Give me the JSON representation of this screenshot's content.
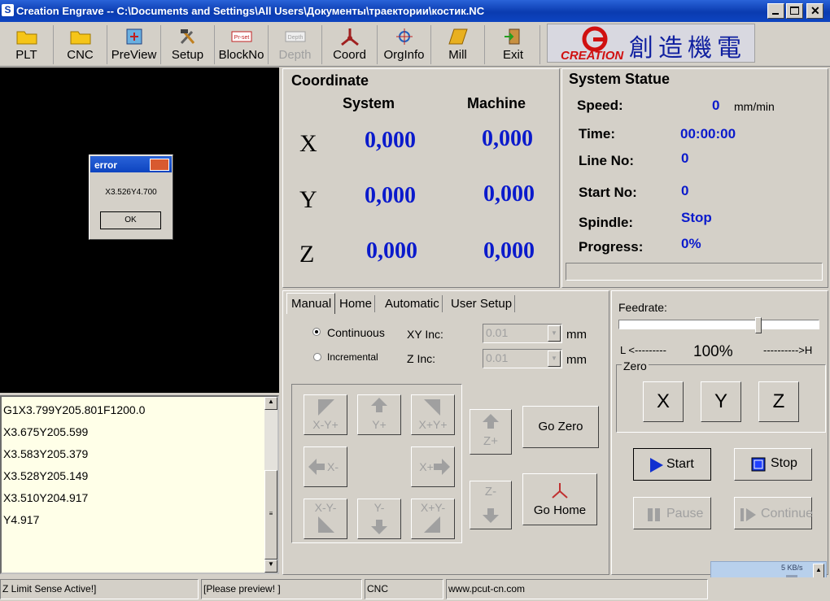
{
  "window": {
    "title": "Creation Engrave -- C:\\Documents and Settings\\All Users\\Документы\\траектории\\костик.NC"
  },
  "toolbar": [
    {
      "label": "PLT",
      "icon": "folder-icon",
      "enabled": true
    },
    {
      "label": "CNC",
      "icon": "folder-icon",
      "enabled": true
    },
    {
      "label": "PreView",
      "icon": "preview-icon",
      "enabled": true
    },
    {
      "label": "Setup",
      "icon": "tools-icon",
      "enabled": true
    },
    {
      "label": "BlockNo",
      "icon": "blockno-icon",
      "enabled": true
    },
    {
      "label": "Depth",
      "icon": "depth-icon",
      "enabled": false
    },
    {
      "label": "Coord",
      "icon": "coord-icon",
      "enabled": true
    },
    {
      "label": "OrgInfo",
      "icon": "orginfo-icon",
      "enabled": true
    },
    {
      "label": "Mill",
      "icon": "mill-icon",
      "enabled": true
    },
    {
      "label": "Exit",
      "icon": "exit-icon",
      "enabled": true
    }
  ],
  "logo": {
    "brand": "CREATION",
    "chinese": "創造機電"
  },
  "error_dialog": {
    "title": "error",
    "message": "X3.526Y4.700",
    "ok": "OK"
  },
  "gcode": [
    "G1X3.799Y205.801F1200.0",
    "X3.675Y205.599",
    "X3.583Y205.379",
    "X3.528Y205.149",
    "X3.510Y204.917",
    "Y4.917"
  ],
  "coordinate": {
    "title": "Coordinate",
    "system_label": "System",
    "machine_label": "Machine",
    "rows": [
      {
        "axis": "X",
        "system": "0,000",
        "machine": "0,000"
      },
      {
        "axis": "Y",
        "system": "0,000",
        "machine": "0,000"
      },
      {
        "axis": "Z",
        "system": "0,000",
        "machine": "0,000"
      }
    ]
  },
  "system_status": {
    "title": "System Statue",
    "speed_label": "Speed:",
    "speed_value": "0",
    "speed_unit": "mm/min",
    "time_label": "Time:",
    "time_value": "00:00:00",
    "line_label": "Line No:",
    "line_value": "0",
    "start_label": "Start No:",
    "start_value": "0",
    "spindle_label": "Spindle:",
    "spindle_value": "Stop",
    "progress_label": "Progress:",
    "progress_value": "0%"
  },
  "tabs": [
    "Manual",
    "Home",
    "Automatic",
    "User Setup"
  ],
  "manual": {
    "continuous": "Continuous",
    "incremental": "Incremental",
    "xy_inc_label": "XY Inc:",
    "xy_inc_value": "0.01",
    "z_inc_label": "Z Inc:",
    "z_inc_value": "0.01",
    "unit": "mm",
    "jog": {
      "xmym": "X-Y+",
      "yp": "Y+",
      "xpyp": "X+Y+",
      "xm": "X-",
      "xp": "X+",
      "xmym2": "X-Y-",
      "ym": "Y-",
      "xpym": "X+Y-",
      "zp": "Z+",
      "zm": "Z-"
    },
    "go_zero": "Go Zero",
    "go_home": "Go Home"
  },
  "feedrate": {
    "label": "Feedrate:",
    "low": "L  <---------",
    "high": "---------->H",
    "percent": "100%",
    "value_fraction": 0.7
  },
  "zero": {
    "label": "Zero",
    "x": "X",
    "y": "Y",
    "z": "Z"
  },
  "control": {
    "start": "Start",
    "stop": "Stop",
    "pause": "Pause",
    "continue": "Continue"
  },
  "network": {
    "speed": "5 KB/s"
  },
  "statusbar": [
    "Z Limit Sense Active!]",
    "[Please preview!  ]",
    "CNC",
    "www.pcut-cn.com"
  ]
}
